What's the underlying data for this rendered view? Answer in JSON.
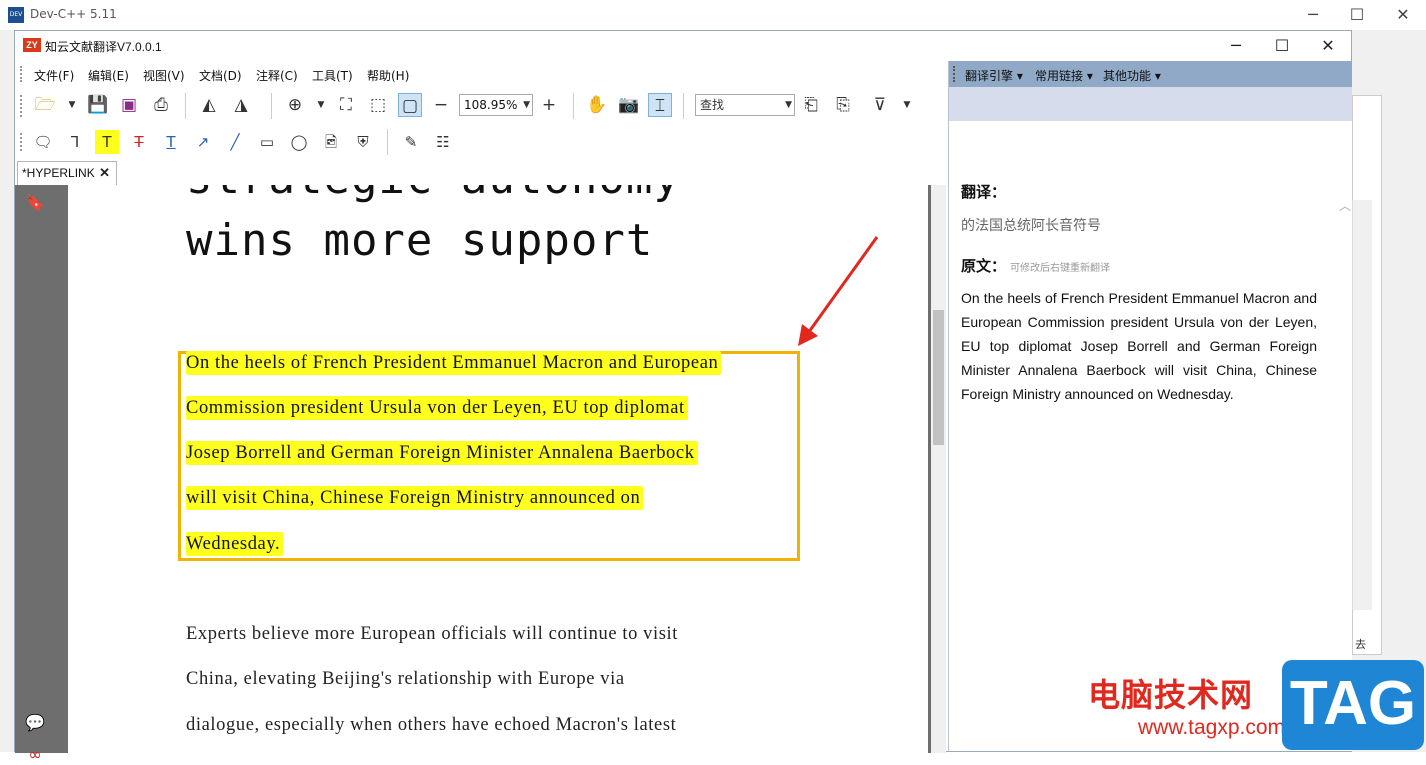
{
  "bg_window": {
    "title": "Dev-C++ 5.11",
    "icon": "DEV",
    "sub_label": "去"
  },
  "window": {
    "title": "知云文献翻译V7.0.0.1",
    "icon": "ZY"
  },
  "menu": [
    "文件(F)",
    "编辑(E)",
    "视图(V)",
    "文档(D)",
    "注释(C)",
    "工具(T)",
    "帮助(H)"
  ],
  "toolbar": {
    "zoom_value": "108.95%",
    "search_value": "查找"
  },
  "tab": {
    "label": "*HYPERLINK",
    "close": "✕"
  },
  "document": {
    "heading_partial": "strategic autonomy",
    "heading": "wins more support",
    "highlighted_lines": [
      "On the heels of French President Emmanuel Macron and European",
      "Commission president Ursula von der Leyen, EU top diplomat",
      "Josep Borrell and German Foreign Minister Annalena Baerbock",
      "will visit China, Chinese Foreign Ministry announced on",
      "Wednesday."
    ],
    "body_lines": [
      "Experts believe more European officials will continue to visit",
      "China, elevating Beijing's relationship with Europe via",
      "dialogue, especially when others have echoed Macron's latest"
    ]
  },
  "translation_panel": {
    "menu": [
      "翻译引擎",
      "常用链接",
      "其他功能"
    ],
    "translation_label": "翻译：",
    "translation_text": "的法国总统阿长音符号",
    "original_label": "原文：",
    "original_hint": "可修改后右键重新翻译",
    "original_text": "On the heels of French President Emmanuel Macron and European Commission president Ursula von der Leyen, EU top diplomat Josep Borrell and German Foreign Minister Annalena Baerbock will visit China, Chinese Foreign Ministry announced on Wednesday."
  },
  "watermark": {
    "cn": "电脑技术网",
    "url": "www.tagxp.com",
    "tag": "TAG"
  },
  "colors": {
    "highlight": "#ffff1e",
    "highlight_border": "#f0b400",
    "arrow": "#e0281e",
    "panel_menu": "#8fa9c6"
  }
}
